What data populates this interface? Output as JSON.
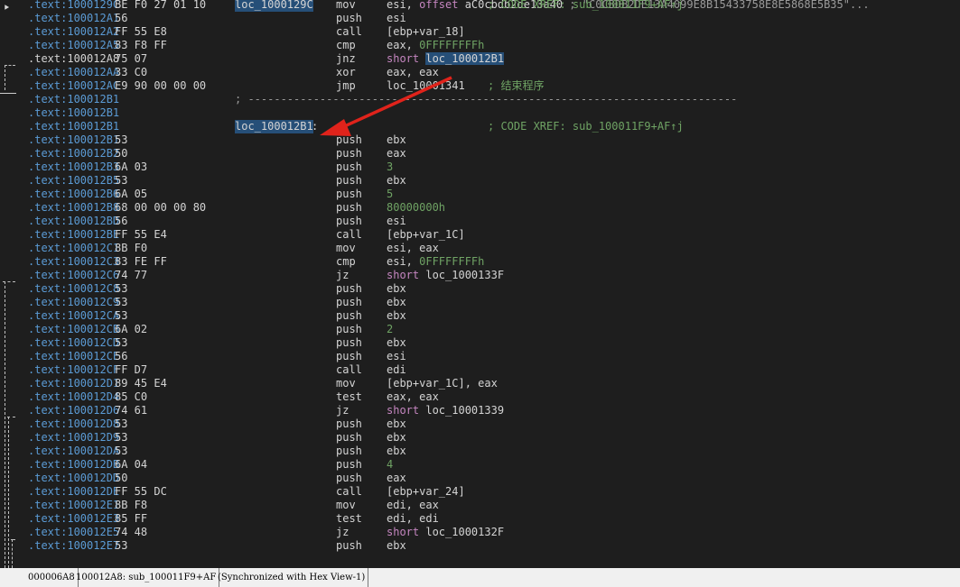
{
  "gutter": {
    "breakpoint_glyph": "⯈"
  },
  "rows": [
    {
      "addr": ".text:1000129C",
      "bytes": "BE F0 27 01 10",
      "mnemonic": "mov",
      "operand_pre": "esi, ",
      "operand_kw": "offset",
      "operand_mid": " aC0cbdb2de13a40",
      "operand_str": " ; \"C0CBDB2DE13A4099E8B15433758E8E5868E5B35\"...",
      "label": "loc_1000129C",
      "xref": "; CODE XREF: sub_100011F9+AF↑j"
    },
    {
      "addr": ".text:100012A1",
      "bytes": "56",
      "mnemonic": "push",
      "operand_pre": "esi"
    },
    {
      "addr": ".text:100012A2",
      "bytes": "FF 55 E8",
      "mnemonic": "call",
      "operand_pre": "[ebp+var_18]"
    },
    {
      "addr": ".text:100012A5",
      "bytes": "83 F8 FF",
      "mnemonic": "cmp",
      "operand_pre": "eax, ",
      "operand_num": "0FFFFFFFFh"
    },
    {
      "addr": ".text:100012A8",
      "bytes": "75 07",
      "mnemonic": "jnz",
      "operand_kw": "short",
      "operand_hl": "loc_100012B1",
      "current": true
    },
    {
      "addr": ".text:100012AA",
      "bytes": "33 C0",
      "mnemonic": "xor",
      "operand_pre": "eax, eax"
    },
    {
      "addr": ".text:100012AC",
      "bytes": "E9 90 00 00 00",
      "mnemonic": "jmp",
      "operand_pre": "loc_10001341",
      "comment": "; 结束程序"
    },
    {
      "addr": ".text:100012B1",
      "separator": "; ---------------------------------------------------------------------------"
    },
    {
      "addr": ".text:100012B1"
    },
    {
      "addr": ".text:100012B1",
      "label": "loc_100012B1",
      "xref": "; CODE XREF: sub_100011F9+AF↑j"
    },
    {
      "addr": ".text:100012B1",
      "bytes": "53",
      "mnemonic": "push",
      "operand_pre": "ebx"
    },
    {
      "addr": ".text:100012B2",
      "bytes": "50",
      "mnemonic": "push",
      "operand_pre": "eax"
    },
    {
      "addr": ".text:100012B3",
      "bytes": "6A 03",
      "mnemonic": "push",
      "operand_num": "3"
    },
    {
      "addr": ".text:100012B5",
      "bytes": "53",
      "mnemonic": "push",
      "operand_pre": "ebx"
    },
    {
      "addr": ".text:100012B6",
      "bytes": "6A 05",
      "mnemonic": "push",
      "operand_num": "5"
    },
    {
      "addr": ".text:100012B8",
      "bytes": "68 00 00 00 80",
      "mnemonic": "push",
      "operand_num": "80000000h"
    },
    {
      "addr": ".text:100012BD",
      "bytes": "56",
      "mnemonic": "push",
      "operand_pre": "esi"
    },
    {
      "addr": ".text:100012BE",
      "bytes": "FF 55 E4",
      "mnemonic": "call",
      "operand_pre": "[ebp+var_1C]"
    },
    {
      "addr": ".text:100012C1",
      "bytes": "8B F0",
      "mnemonic": "mov",
      "operand_pre": "esi, eax"
    },
    {
      "addr": ".text:100012C3",
      "bytes": "83 FE FF",
      "mnemonic": "cmp",
      "operand_pre": "esi, ",
      "operand_num": "0FFFFFFFFh"
    },
    {
      "addr": ".text:100012C6",
      "bytes": "74 77",
      "mnemonic": "jz",
      "operand_kw": "short",
      "operand_post": " loc_1000133F"
    },
    {
      "addr": ".text:100012C8",
      "bytes": "53",
      "mnemonic": "push",
      "operand_pre": "ebx"
    },
    {
      "addr": ".text:100012C9",
      "bytes": "53",
      "mnemonic": "push",
      "operand_pre": "ebx"
    },
    {
      "addr": ".text:100012CA",
      "bytes": "53",
      "mnemonic": "push",
      "operand_pre": "ebx"
    },
    {
      "addr": ".text:100012CB",
      "bytes": "6A 02",
      "mnemonic": "push",
      "operand_num": "2"
    },
    {
      "addr": ".text:100012CD",
      "bytes": "53",
      "mnemonic": "push",
      "operand_pre": "ebx"
    },
    {
      "addr": ".text:100012CE",
      "bytes": "56",
      "mnemonic": "push",
      "operand_pre": "esi"
    },
    {
      "addr": ".text:100012CF",
      "bytes": "FF D7",
      "mnemonic": "call",
      "operand_pre": "edi"
    },
    {
      "addr": ".text:100012D1",
      "bytes": "89 45 E4",
      "mnemonic": "mov",
      "operand_pre": "[ebp+var_1C], eax"
    },
    {
      "addr": ".text:100012D4",
      "bytes": "85 C0",
      "mnemonic": "test",
      "operand_pre": "eax, eax"
    },
    {
      "addr": ".text:100012D6",
      "bytes": "74 61",
      "mnemonic": "jz",
      "operand_kw": "short",
      "operand_post": " loc_10001339"
    },
    {
      "addr": ".text:100012D8",
      "bytes": "53",
      "mnemonic": "push",
      "operand_pre": "ebx"
    },
    {
      "addr": ".text:100012D9",
      "bytes": "53",
      "mnemonic": "push",
      "operand_pre": "ebx"
    },
    {
      "addr": ".text:100012DA",
      "bytes": "53",
      "mnemonic": "push",
      "operand_pre": "ebx"
    },
    {
      "addr": ".text:100012DB",
      "bytes": "6A 04",
      "mnemonic": "push",
      "operand_num": "4"
    },
    {
      "addr": ".text:100012DD",
      "bytes": "50",
      "mnemonic": "push",
      "operand_pre": "eax"
    },
    {
      "addr": ".text:100012DE",
      "bytes": "FF 55 DC",
      "mnemonic": "call",
      "operand_pre": "[ebp+var_24]"
    },
    {
      "addr": ".text:100012E1",
      "bytes": "8B F8",
      "mnemonic": "mov",
      "operand_pre": "edi, eax"
    },
    {
      "addr": ".text:100012E3",
      "bytes": "85 FF",
      "mnemonic": "test",
      "operand_pre": "edi, edi"
    },
    {
      "addr": ".text:100012E5",
      "bytes": "74 48",
      "mnemonic": "jz",
      "operand_kw": "short",
      "operand_post": " loc_1000132F"
    },
    {
      "addr": ".text:100012E7",
      "bytes": "53",
      "mnemonic": "push",
      "operand_pre": "ebx"
    }
  ],
  "statusbar": {
    "offset": "000006A8",
    "location": "100012A8: sub_100011F9+AF",
    "sync": "(Synchronized with Hex View-1)"
  },
  "colors": {
    "background": "#1e1e1e",
    "address": "#5b9bd5",
    "number": "#6fa364",
    "keyword": "#c586c0",
    "highlight": "#264f78",
    "annotation_arrow": "#e0231b"
  }
}
